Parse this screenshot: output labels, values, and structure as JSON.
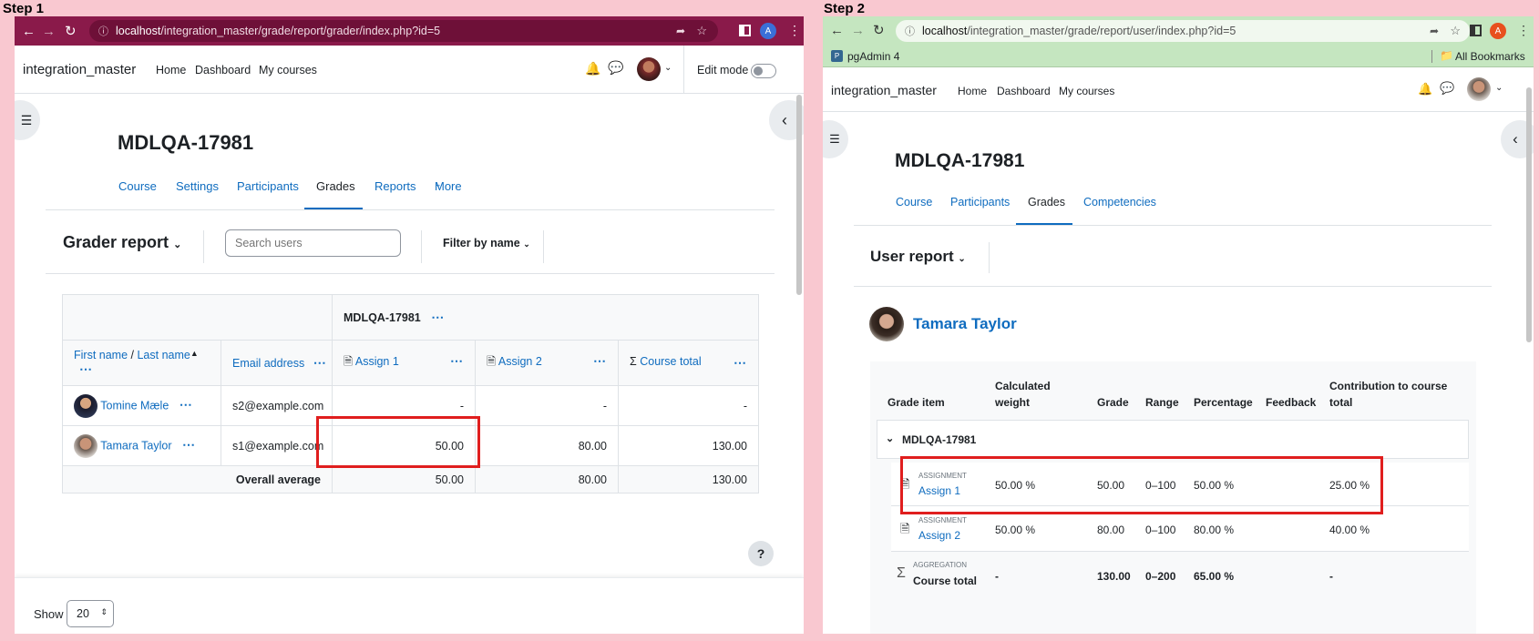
{
  "step1": {
    "label": "Step 1",
    "url_host": "localhost",
    "url_path": "/integration_master/grade/report/grader/index.php?id=5",
    "profile_letter": "A",
    "site_name": "integration_master",
    "nav": [
      "Home",
      "Dashboard",
      "My courses"
    ],
    "edit_mode": "Edit mode",
    "course_title": "MDLQA-17981",
    "tabs": [
      "Course",
      "Settings",
      "Participants",
      "Grades",
      "Reports",
      "More"
    ],
    "report_title": "Grader report",
    "search_placeholder": "Search users",
    "filter_label": "Filter by name",
    "table": {
      "category": "MDLQA-17981",
      "first_name": "First name",
      "slash": " / ",
      "last_name": "Last name",
      "email_header": "Email address",
      "assign1": "Assign 1",
      "assign2": "Assign 2",
      "course_total": "Course total",
      "rows": [
        {
          "name": "Tomine Mæle",
          "email": "s2@example.com",
          "a1": "-",
          "a2": "-",
          "total": "-"
        },
        {
          "name": "Tamara Taylor",
          "email": "s1@example.com",
          "a1": "50.00",
          "a2": "80.00",
          "total": "130.00"
        }
      ],
      "avg_label": "Overall average",
      "avg": {
        "a1": "50.00",
        "a2": "80.00",
        "total": "130.00"
      }
    },
    "show_label": "Show",
    "show_value": "20",
    "help": "?"
  },
  "step2": {
    "label": "Step 2",
    "url_host": "localhost",
    "url_path": "/integration_master/grade/report/user/index.php?id=5",
    "profile_letter": "A",
    "bookmark": "pgAdmin 4",
    "all_bookmarks": "All Bookmarks",
    "site_name": "integration_master",
    "nav": [
      "Home",
      "Dashboard",
      "My courses"
    ],
    "course_title": "MDLQA-17981",
    "tabs": [
      "Course",
      "Participants",
      "Grades",
      "Competencies"
    ],
    "report_title": "User report",
    "user_name": "Tamara Taylor",
    "headers": {
      "item": "Grade item",
      "weight1": "Calculated",
      "weight2": "weight",
      "grade": "Grade",
      "range": "Range",
      "percentage": "Percentage",
      "feedback": "Feedback",
      "contrib1": "Contribution to course",
      "contrib2": "total"
    },
    "category": "MDLQA-17981",
    "rows": [
      {
        "type": "ASSIGNMENT",
        "name": "Assign 1",
        "weight": "50.00 %",
        "grade": "50.00",
        "range": "0–100",
        "percentage": "50.00 %",
        "contribution": "25.00 %"
      },
      {
        "type": "ASSIGNMENT",
        "name": "Assign 2",
        "weight": "50.00 %",
        "grade": "80.00",
        "range": "0–100",
        "percentage": "80.00 %",
        "contribution": "40.00 %"
      }
    ],
    "total": {
      "type": "AGGREGATION",
      "name": "Course total",
      "weight": "-",
      "grade": "130.00",
      "range": "0–200",
      "percentage": "65.00 %",
      "contribution": "-"
    }
  },
  "colors": {
    "header_bar": "#8a1a4a",
    "link": "#0f6cbf",
    "highlight": "#e01e1e",
    "bookmark_bar": "#c5e6c0"
  }
}
